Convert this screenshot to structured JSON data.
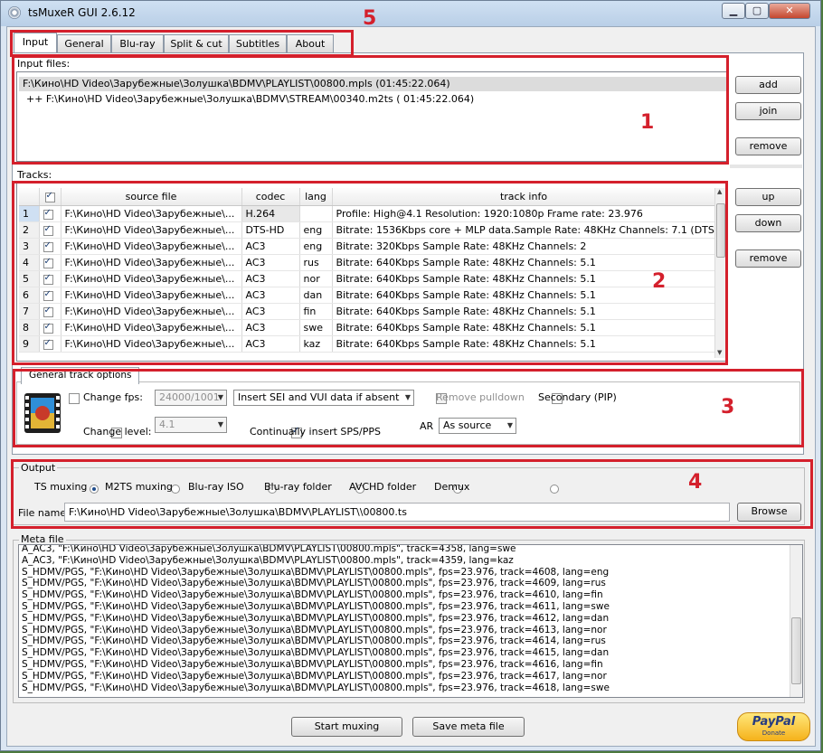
{
  "window": {
    "title": "tsMuxeR GUI 2.6.12"
  },
  "tabs": [
    "Input",
    "General",
    "Blu-ray",
    "Split & cut",
    "Subtitles",
    "About"
  ],
  "annotations": [
    "1",
    "2",
    "3",
    "4",
    "5"
  ],
  "input_files": {
    "label": "Input files:",
    "items": [
      "F:\\Кино\\HD Video\\Зарубежные\\Золушка\\BDMV\\PLAYLIST\\00800.mpls (01:45:22.064)",
      "++ F:\\Кино\\HD Video\\Зарубежные\\Золушка\\BDMV\\STREAM\\00340.m2ts ( 01:45:22.064)"
    ],
    "buttons": {
      "add": "add",
      "join": "join",
      "remove": "remove"
    }
  },
  "tracks": {
    "label": "Tracks:",
    "columns": [
      "source file",
      "codec",
      "lang",
      "track info"
    ],
    "rows": [
      {
        "n": "1",
        "file": "F:\\Кино\\HD Video\\Зарубежные\\...",
        "codec": "H.264",
        "lang": "",
        "info": "Profile: High@4.1  Resolution: 1920:1080p  Frame rate: 23.976"
      },
      {
        "n": "2",
        "file": "F:\\Кино\\HD Video\\Зарубежные\\...",
        "codec": "DTS-HD",
        "lang": "eng",
        "info": "Bitrate: 1536Kbps  core + MLP data.Sample Rate: 48KHz  Channels: 7.1 (DTS ..."
      },
      {
        "n": "3",
        "file": "F:\\Кино\\HD Video\\Зарубежные\\...",
        "codec": "AC3",
        "lang": "eng",
        "info": "Bitrate: 320Kbps Sample Rate: 48KHz Channels: 2"
      },
      {
        "n": "4",
        "file": "F:\\Кино\\HD Video\\Зарубежные\\...",
        "codec": "AC3",
        "lang": "rus",
        "info": "Bitrate: 640Kbps Sample Rate: 48KHz Channels: 5.1"
      },
      {
        "n": "5",
        "file": "F:\\Кино\\HD Video\\Зарубежные\\...",
        "codec": "AC3",
        "lang": "nor",
        "info": "Bitrate: 640Kbps Sample Rate: 48KHz Channels: 5.1"
      },
      {
        "n": "6",
        "file": "F:\\Кино\\HD Video\\Зарубежные\\...",
        "codec": "AC3",
        "lang": "dan",
        "info": "Bitrate: 640Kbps Sample Rate: 48KHz Channels: 5.1"
      },
      {
        "n": "7",
        "file": "F:\\Кино\\HD Video\\Зарубежные\\...",
        "codec": "AC3",
        "lang": "fin",
        "info": "Bitrate: 640Kbps Sample Rate: 48KHz Channels: 5.1"
      },
      {
        "n": "8",
        "file": "F:\\Кино\\HD Video\\Зарубежные\\...",
        "codec": "AC3",
        "lang": "swe",
        "info": "Bitrate: 640Kbps Sample Rate: 48KHz Channels: 5.1"
      },
      {
        "n": "9",
        "file": "F:\\Кино\\HD Video\\Зарубежные\\...",
        "codec": "AC3",
        "lang": "kaz",
        "info": "Bitrate: 640Kbps Sample Rate: 48KHz Channels: 5.1"
      }
    ],
    "buttons": {
      "up": "up",
      "down": "down",
      "remove": "remove"
    }
  },
  "track_options": {
    "title": "General track options",
    "change_fps": "Change fps:",
    "fps_value": "24000/1001",
    "sei_option": "Insert SEI and VUI data if absent",
    "remove_pulldown": "Remove pulldown",
    "secondary": "Secondary (PIP)",
    "change_level": "Change level:",
    "level_value": "4.1",
    "sps_pps": "Continually insert SPS/PPS",
    "ar_label": "AR",
    "ar_value": "As source"
  },
  "output": {
    "label": "Output",
    "modes": [
      "TS muxing",
      "M2TS muxing",
      "Blu-ray ISO",
      "Blu-ray folder",
      "AVCHD folder",
      "Demux"
    ],
    "file_name_label": "File name",
    "file_name": "F:\\Кино\\HD Video\\Зарубежные\\Золушка\\BDMV\\PLAYLIST\\\\00800.ts",
    "browse": "Browse"
  },
  "meta": {
    "label": "Meta file",
    "lines": [
      "A_AC3, \"F:\\Кино\\HD Video\\Зарубежные\\Золушка\\BDMV\\PLAYLIST\\00800.mpls\", track=4358, lang=swe",
      "A_AC3, \"F:\\Кино\\HD Video\\Зарубежные\\Золушка\\BDMV\\PLAYLIST\\00800.mpls\", track=4359, lang=kaz",
      "S_HDMV/PGS, \"F:\\Кино\\HD Video\\Зарубежные\\Золушка\\BDMV\\PLAYLIST\\00800.mpls\", fps=23.976, track=4608, lang=eng",
      "S_HDMV/PGS, \"F:\\Кино\\HD Video\\Зарубежные\\Золушка\\BDMV\\PLAYLIST\\00800.mpls\", fps=23.976, track=4609, lang=rus",
      "S_HDMV/PGS, \"F:\\Кино\\HD Video\\Зарубежные\\Золушка\\BDMV\\PLAYLIST\\00800.mpls\", fps=23.976, track=4610, lang=fin",
      "S_HDMV/PGS, \"F:\\Кино\\HD Video\\Зарубежные\\Золушка\\BDMV\\PLAYLIST\\00800.mpls\", fps=23.976, track=4611, lang=swe",
      "S_HDMV/PGS, \"F:\\Кино\\HD Video\\Зарубежные\\Золушка\\BDMV\\PLAYLIST\\00800.mpls\", fps=23.976, track=4612, lang=dan",
      "S_HDMV/PGS, \"F:\\Кино\\HD Video\\Зарубежные\\Золушка\\BDMV\\PLAYLIST\\00800.mpls\", fps=23.976, track=4613, lang=nor",
      "S_HDMV/PGS, \"F:\\Кино\\HD Video\\Зарубежные\\Золушка\\BDMV\\PLAYLIST\\00800.mpls\", fps=23.976, track=4614, lang=rus",
      "S_HDMV/PGS, \"F:\\Кино\\HD Video\\Зарубежные\\Золушка\\BDMV\\PLAYLIST\\00800.mpls\", fps=23.976, track=4615, lang=dan",
      "S_HDMV/PGS, \"F:\\Кино\\HD Video\\Зарубежные\\Золушка\\BDMV\\PLAYLIST\\00800.mpls\", fps=23.976, track=4616, lang=fin",
      "S_HDMV/PGS, \"F:\\Кино\\HD Video\\Зарубежные\\Золушка\\BDMV\\PLAYLIST\\00800.mpls\", fps=23.976, track=4617, lang=nor",
      "S_HDMV/PGS, \"F:\\Кино\\HD Video\\Зарубежные\\Золушка\\BDMV\\PLAYLIST\\00800.mpls\", fps=23.976, track=4618, lang=swe"
    ]
  },
  "footer": {
    "start": "Start muxing",
    "save_meta": "Save meta file",
    "paypal": "PayPal",
    "donate": "Donate"
  }
}
